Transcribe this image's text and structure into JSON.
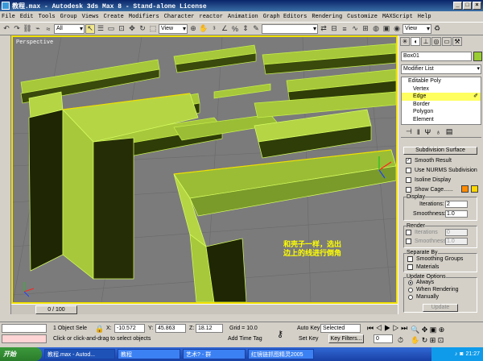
{
  "window": {
    "title": "教程.max - Autodesk 3ds Max 8 - Stand-alone License"
  },
  "menu": [
    "File",
    "Edit",
    "Tools",
    "Group",
    "Views",
    "Create",
    "Modifiers",
    "Character",
    "reactor",
    "Animation",
    "Graph Editors",
    "Rendering",
    "Customize",
    "MAXScript",
    "Help"
  ],
  "toolbar": {
    "filter": "All",
    "coord": "View",
    "coord2": "View",
    "named_sel": ""
  },
  "viewport": {
    "label": "Perspective",
    "annotation_line1": "和壳子一样，选出",
    "annotation_line2": "边上的线进行倒角"
  },
  "time_slider": {
    "label": "0 / 100"
  },
  "command_panel": {
    "object_name": "Box01",
    "modifier_list": "Modifier List",
    "stack": {
      "root": "Editable Poly",
      "items": [
        "Vertex",
        "Edge",
        "Border",
        "Polygon",
        "Element"
      ],
      "selected": "Edge"
    },
    "subdiv": {
      "header": "Subdivision Surface",
      "smooth_result": "Smooth Result",
      "use_nurms": "Use NURMS Subdivision",
      "isoline": "Isoline Display",
      "show_cage": "Show Cage......",
      "display_group": "Display",
      "iterations_label": "Iterations:",
      "iterations_val": "2",
      "smoothness_label": "Smoothness:",
      "smoothness_val": "1.0",
      "render_group": "Render",
      "r_iterations_label": "Iterations",
      "r_iterations_val": "0",
      "r_smoothness_label": "Smoothness:",
      "r_smoothness_val": "1.0",
      "separate_group": "Separate By",
      "smoothing_groups": "Smoothing Groups",
      "materials": "Materials",
      "update_group": "Update Options",
      "always": "Always",
      "when_rendering": "When Rendering",
      "manually": "Manually",
      "update_btn": "Update"
    }
  },
  "status": {
    "selection": "1 Object Sele",
    "x_label": "X:",
    "x": "-10.572",
    "y_label": "Y:",
    "y": "45.863",
    "z_label": "Z:",
    "z": "18.12",
    "grid": "Grid = 10.0",
    "auto_key": "Auto Key",
    "set_key": "Set Key",
    "selected_combo": "Selected",
    "key_filters": "Key Filters...",
    "prompt": "Click or click-and-drag to select objects",
    "add_time_tag": "Add Time Tag",
    "frame": "0"
  },
  "taskbar": {
    "start": "开始",
    "tasks": [
      "教程.max - Autod...",
      "教程",
      "艺术? - 群",
      "红镜链抓图精灵2005"
    ],
    "active_index": 0,
    "clock": "21:27"
  },
  "colors": {
    "mesh": "#9acd32",
    "selected_edge": "#f0e000",
    "viewport_bg": "#7b7b7b"
  }
}
